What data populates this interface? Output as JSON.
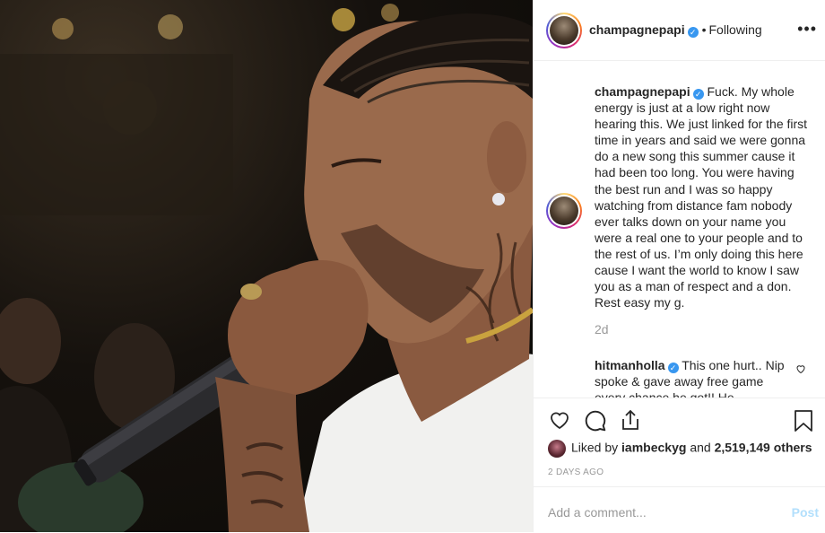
{
  "header": {
    "username": "champagnepapi",
    "verified": true,
    "separator": "•",
    "follow_status": "Following",
    "more_label": "•••"
  },
  "caption": {
    "username": "champagnepapi",
    "verified": true,
    "text": "Fuck. My whole energy is just at a low right now hearing this. We just linked for the first time in years and said we were gonna do a new song this summer cause it had been too long. You were having the best run and I was so happy watching from distance fam nobody ever talks down on your name you were a real one to your people and to the rest of us. I’m only doing this here cause I want the world to know I saw you as a man of respect and a don. Rest easy my g.",
    "time": "2d"
  },
  "comments": [
    {
      "username": "hitmanholla",
      "verified": true,
      "text": "This one hurt.. Nip spoke & gave away free game every chance he got!! He"
    }
  ],
  "actions": {
    "like_icon": "heart-icon",
    "comment_icon": "comment-icon",
    "share_icon": "share-icon",
    "save_icon": "bookmark-icon"
  },
  "likes": {
    "prefix": "Liked by",
    "user": "iambeckyg",
    "connector": "and",
    "count": "2,519,149 others"
  },
  "posted": "2 DAYS AGO",
  "add_comment": {
    "placeholder": "Add a comment...",
    "post_label": "Post"
  },
  "colors": {
    "verified": "#3897f0",
    "post_button": "#b2dffc",
    "muted_text": "#999999"
  }
}
